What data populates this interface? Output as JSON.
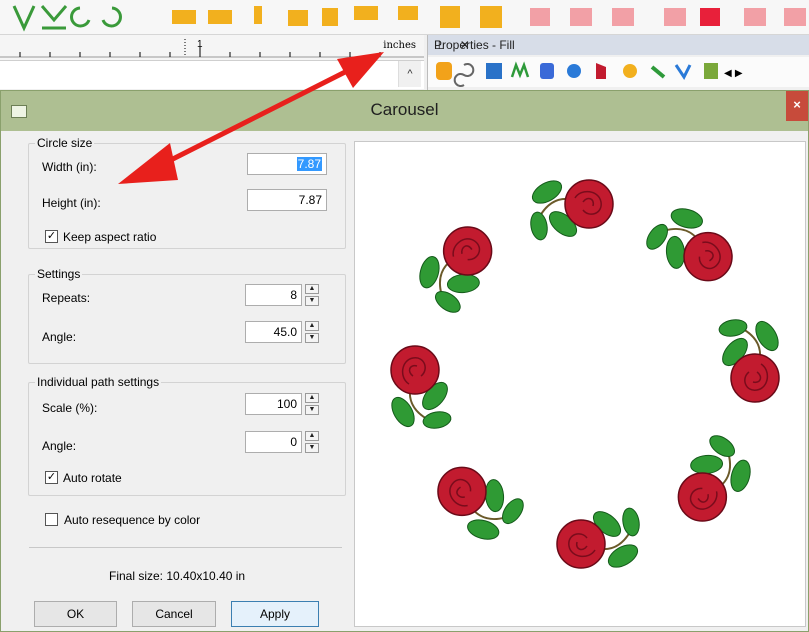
{
  "ruler": {
    "units": "inches",
    "tick_number": "1"
  },
  "properties_panel": {
    "title": "Properties - Fill",
    "controls": "— ✕"
  },
  "dialog": {
    "title": "Carousel",
    "close_label": "×",
    "circle_size": {
      "group_title": "Circle size",
      "width_label": "Width (in):",
      "width_value": "7.87",
      "height_label": "Height (in):",
      "height_value": "7.87",
      "keep_aspect_label": "Keep aspect ratio",
      "keep_aspect_checked": true
    },
    "settings": {
      "group_title": "Settings",
      "repeats_label": "Repeats:",
      "repeats_value": "8",
      "angle_label": "Angle:",
      "angle_value": "45.0"
    },
    "individual": {
      "group_title": "Individual path settings",
      "scale_label": "Scale (%):",
      "scale_value": "100",
      "angle_label": "Angle:",
      "angle_value": "0",
      "auto_rotate_label": "Auto rotate",
      "auto_rotate_checked": true
    },
    "auto_resequence_label": "Auto resequence by color",
    "auto_resequence_checked": false,
    "final_size": "Final size: 10.40x10.40 in",
    "buttons": {
      "ok": "OK",
      "cancel": "Cancel",
      "apply": "Apply"
    },
    "preview": {
      "repeats": 8,
      "angle_step_deg": 45
    }
  },
  "colors": {
    "titlebar": "#aebf92",
    "close": "#c74b3b",
    "arrow": "#e8201c",
    "rose": "#c21b2f",
    "leaf": "#2f9a34"
  }
}
